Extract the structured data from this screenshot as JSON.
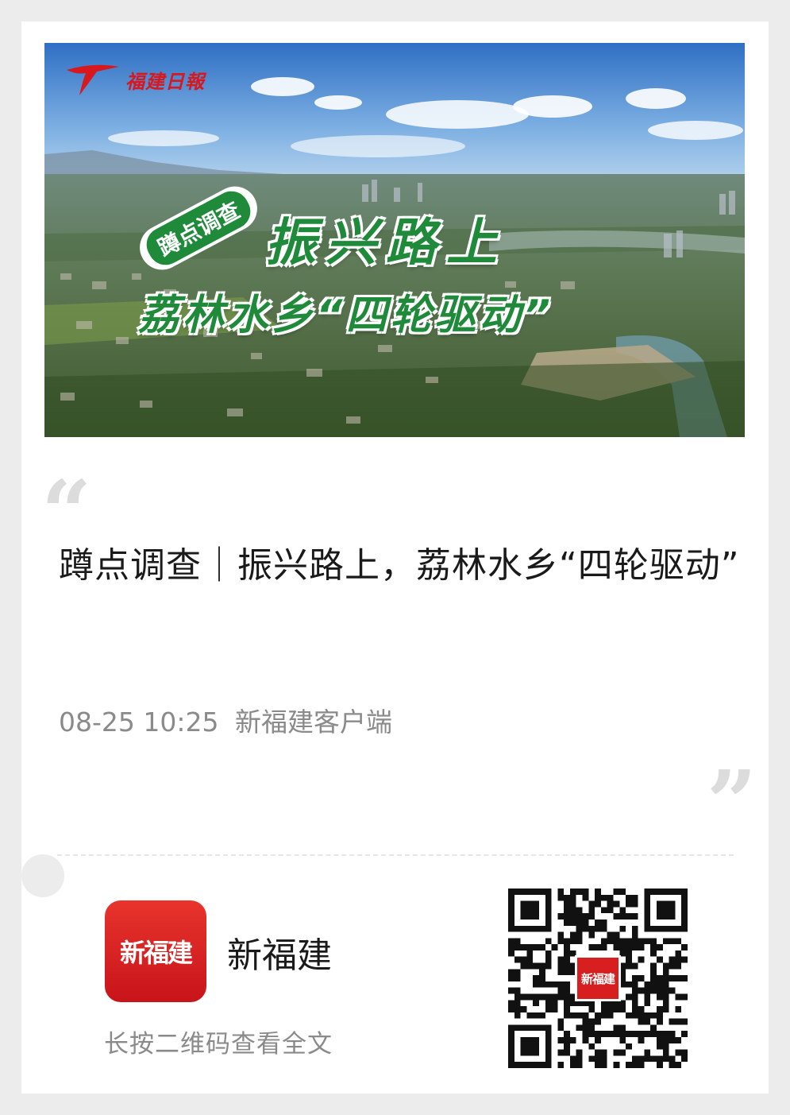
{
  "banner": {
    "logo_text": "福建日報",
    "badge": "蹲点调查",
    "headline_line1": "振兴路上",
    "headline_line2": "荔林水乡“四轮驱动”"
  },
  "article": {
    "title": "蹲点调查｜振兴路上，荔林水乡“四轮驱动”",
    "date": "08-25 10:25",
    "source": "新福建客户端",
    "quote_open": "“",
    "quote_close": "”"
  },
  "footer": {
    "app_logo_text": "新福建",
    "app_name": "新福建",
    "hint": "长按二维码查看全文",
    "qr_logo_text": "新福建"
  },
  "colors": {
    "brand_red": "#d71f1f",
    "title_text": "#1a1a1a",
    "meta_text": "#8a8a8a"
  },
  "icons": [
    "quote-open-icon",
    "quote-close-icon",
    "qr-code-icon"
  ]
}
